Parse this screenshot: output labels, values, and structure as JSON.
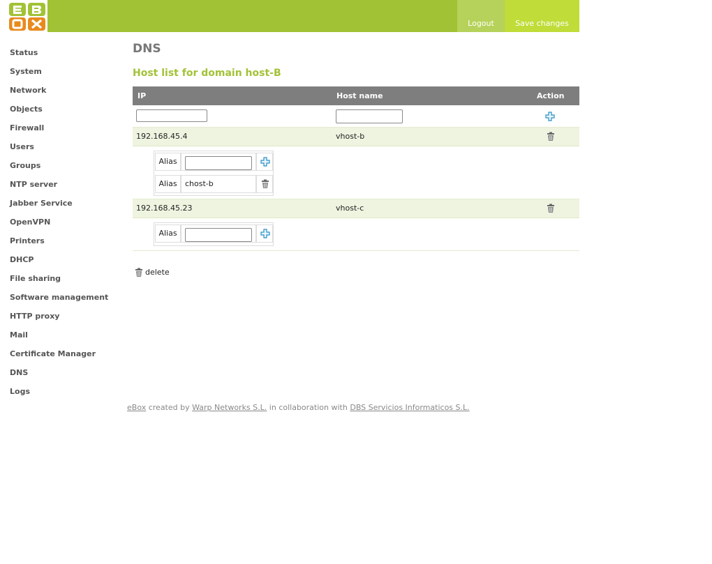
{
  "header": {
    "logout_label": "Logout",
    "save_label": "Save changes",
    "colors": {
      "bar": "#a2c236",
      "logout_bg": "#b6d25a",
      "save_bg": "#bfdc38"
    }
  },
  "sidebar": {
    "items": [
      "Status",
      "System",
      "Network",
      "Objects",
      "Firewall",
      "Users",
      "Groups",
      "NTP server",
      "Jabber Service",
      "OpenVPN",
      "Printers",
      "DHCP",
      "File sharing",
      "Software management",
      "HTTP proxy",
      "Mail",
      "Certificate Manager",
      "DNS",
      "Logs"
    ]
  },
  "main": {
    "title": "DNS",
    "subtitle": "Host list for domain host-B",
    "table": {
      "headers": {
        "ip": "IP",
        "hostname": "Host name",
        "action": "Action"
      },
      "new_row": {
        "ip_value": "",
        "hostname_value": ""
      },
      "hosts": [
        {
          "ip": "192.168.45.4",
          "hostname": "vhost-b",
          "alias_label": "Alias",
          "aliases": [
            {
              "label": "Alias",
              "value": "chost-b"
            }
          ]
        },
        {
          "ip": "192.168.45.23",
          "hostname": "vhost-c",
          "alias_label": "Alias",
          "aliases": []
        }
      ]
    },
    "legend": {
      "delete_label": "delete",
      "icon": "trash-icon"
    }
  },
  "footer": {
    "link_ebox": "eBox",
    "text_created": "created by",
    "link_warp": "Warp Networks S.L.",
    "text_collab": "in collaboration with",
    "link_dbs": "DBS Servicios Informaticos S.L."
  }
}
